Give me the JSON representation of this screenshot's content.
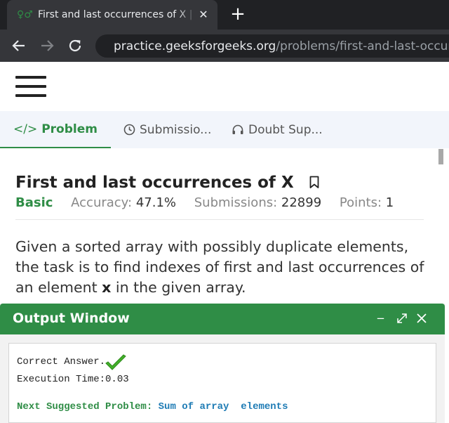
{
  "browser": {
    "tab_title": "First and last occurrences of X | Practice",
    "tab_favicon": "gfg-logo-icon",
    "url_host": "practice.geeksforgeeks.org",
    "url_path": "/problems/first-and-last-occurrences-of-x"
  },
  "tabs": {
    "problem": "Problem",
    "submissions": "Submissio...",
    "doubt": "Doubt Sup..."
  },
  "problem": {
    "title": "First and last occurrences of X",
    "difficulty": "Basic",
    "accuracy_label": "Accuracy:",
    "accuracy_value": "47.1%",
    "submissions_label": "Submissions:",
    "submissions_value": "22899",
    "points_label": "Points:",
    "points_value": "1",
    "desc_part1": "Given a sorted array with possibly duplicate elements, the task is to find indexes of first and last occurrences of an element ",
    "desc_bold": "x",
    "desc_part2": " in the given array."
  },
  "output": {
    "title": "Output Window",
    "line1": "Correct Answer.",
    "line2": "Execution Time:0.03",
    "suggest_label": "Next Suggested Problem:",
    "suggest_value": "Sum of array  elements"
  },
  "colors": {
    "accent": "#2f8d46",
    "link": "#1f7cb5"
  }
}
